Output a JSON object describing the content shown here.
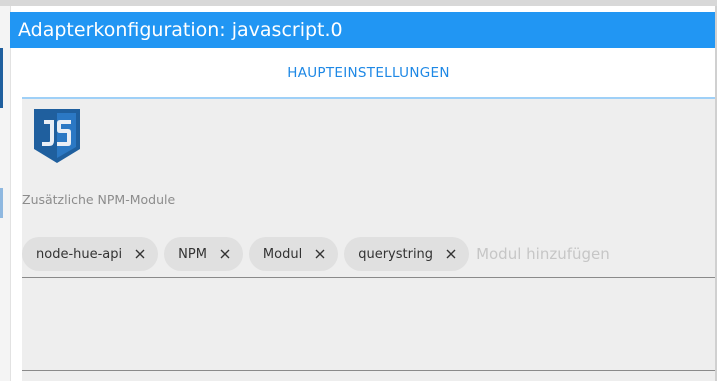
{
  "window": {
    "title": "Adapterkonfiguration: javascript.0"
  },
  "tabs": [
    {
      "label": "HAUPTEINSTELLUNGEN",
      "active": true
    }
  ],
  "logo": {
    "icon": "javascript-logo-icon",
    "text": "JS",
    "color": "#1f5f9e"
  },
  "npm_modules": {
    "label": "Zusätzliche NPM-Module",
    "chips": [
      {
        "label": "node-hue-api",
        "remove_icon": "close-icon"
      },
      {
        "label": "NPM",
        "remove_icon": "close-icon"
      },
      {
        "label": "Modul",
        "remove_icon": "close-icon"
      },
      {
        "label": "querystring",
        "remove_icon": "close-icon"
      }
    ],
    "input": {
      "value": "",
      "placeholder": "Modul hinzufügen"
    }
  },
  "colors": {
    "accent": "#2196f3",
    "tab_text": "#1e88e5",
    "background": "#eeeeee",
    "chip": "#e0e0e0"
  }
}
